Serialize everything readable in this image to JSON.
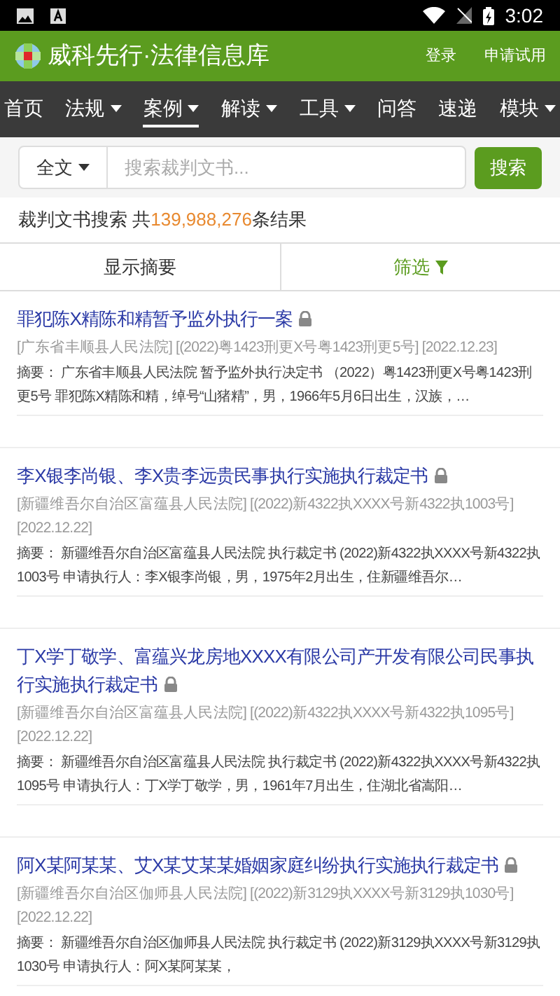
{
  "status_bar": {
    "time": "3:02"
  },
  "header": {
    "brand": "威科先行",
    "brand_suffix": "·法律信息库",
    "actions": [
      "登录",
      "申请试用"
    ]
  },
  "nav": [
    {
      "label": "首页",
      "dropdown": false,
      "selected": false
    },
    {
      "label": "法规",
      "dropdown": true,
      "selected": false
    },
    {
      "label": "案例",
      "dropdown": true,
      "selected": true
    },
    {
      "label": "解读",
      "dropdown": true,
      "selected": false
    },
    {
      "label": "工具",
      "dropdown": true,
      "selected": false
    },
    {
      "label": "问答",
      "dropdown": false,
      "selected": false
    },
    {
      "label": "速递",
      "dropdown": false,
      "selected": false
    },
    {
      "label": "模块",
      "dropdown": true,
      "selected": false
    }
  ],
  "search": {
    "scope": "全文",
    "placeholder": "搜索裁判文书...",
    "button": "搜索"
  },
  "result_summary": {
    "prefix": "裁判文书搜索 共",
    "count": "139,988,276",
    "suffix": "条结果"
  },
  "toolbar": {
    "left": "显示摘要",
    "right": "筛选"
  },
  "results": [
    {
      "title": "罪犯陈X精陈和精暂予监外执行一案",
      "locked": true,
      "meta": "[广东省丰顺县人民法院] [(2022)粤1423刑更X号粤1423刑更5号] [2022.12.23]",
      "summary": "摘要： 广东省丰顺县人民法院 暂予监外执行决定书 （2022）粤1423刑更X号粤1423刑更5号 罪犯陈X精陈和精，绰号“山猪精”，男，1966年5月6日出生，汉族，…"
    },
    {
      "title": "李X银李尚银、李X贵李远贵民事执行实施执行裁定书",
      "locked": true,
      "meta": "[新疆维吾尔自治区富蕴县人民法院] [(2022)新4322执XXXX号新4322执1003号] [2022.12.22]",
      "summary": "摘要： 新疆维吾尔自治区富蕴县人民法院 执行裁定书 (2022)新4322执XXXX号新4322执1003号 申请执行人：李X银李尚银，男，1975年2月出生，住新疆维吾尔…"
    },
    {
      "title": "丁X学丁敬学、富蕴兴龙房地XXXX有限公司产开发有限公司民事执行实施执行裁定书",
      "locked": true,
      "meta": "[新疆维吾尔自治区富蕴县人民法院] [(2022)新4322执XXXX号新4322执1095号] [2022.12.22]",
      "summary": "摘要： 新疆维吾尔自治区富蕴县人民法院 执行裁定书 (2022)新4322执XXXX号新4322执1095号 申请执行人：丁X学丁敬学，男，1961年7月出生，住湖北省嵩阳…"
    },
    {
      "title": "阿X某阿某某、艾X某艾某某婚姻家庭纠纷执行实施执行裁定书",
      "locked": true,
      "meta": "[新疆维吾尔自治区伽师县人民法院] [(2022)新3129执XXXX号新3129执1030号] [2022.12.22]",
      "summary": "摘要： 新疆维吾尔自治区伽师县人民法院 执行裁定书 (2022)新3129执XXXX号新3129执1030号 申请执行人：阿X某阿某某，"
    }
  ]
}
